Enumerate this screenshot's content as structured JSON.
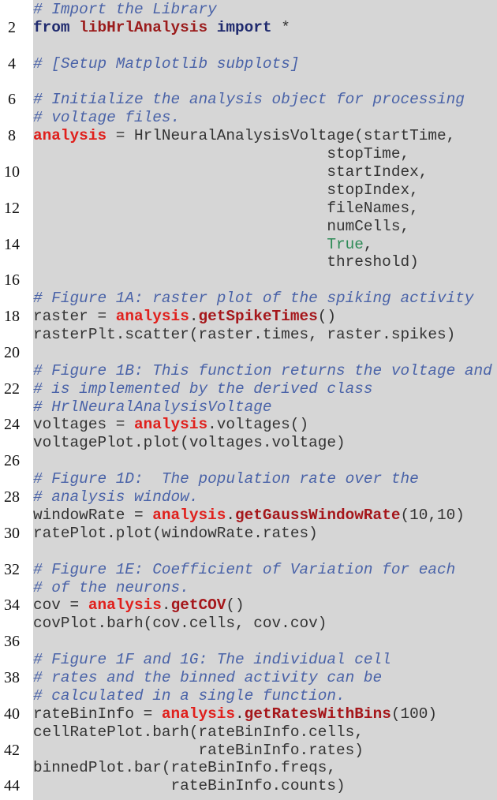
{
  "colors": {
    "background": "#d6d6d6",
    "comment": "#4a63a8",
    "keyword": "#1f2a6e",
    "module": "#9b1c1c",
    "object": "#e0201c",
    "method": "#a5161a",
    "boolean": "#2e8b57",
    "plain": "#333333"
  },
  "lines": [
    {
      "n": "",
      "tokens": [
        {
          "t": "cm",
          "v": "# Import the Library"
        }
      ]
    },
    {
      "n": "2",
      "tokens": [
        {
          "t": "kw",
          "v": "from "
        },
        {
          "t": "mod",
          "v": "libHrlAnalysis"
        },
        {
          "t": "kw",
          "v": " import"
        },
        {
          "t": "pl",
          "v": " *"
        }
      ]
    },
    {
      "n": "",
      "tokens": []
    },
    {
      "n": "4",
      "tokens": [
        {
          "t": "cm",
          "v": "# [Setup Matplotlib subplots]"
        }
      ]
    },
    {
      "n": "",
      "tokens": []
    },
    {
      "n": "6",
      "tokens": [
        {
          "t": "cm",
          "v": "# Initialize the analysis object for processing"
        }
      ]
    },
    {
      "n": "",
      "tokens": [
        {
          "t": "cm",
          "v": "# voltage files."
        }
      ]
    },
    {
      "n": "8",
      "tokens": [
        {
          "t": "obj",
          "v": "analysis"
        },
        {
          "t": "pl",
          "v": " = HrlNeuralAnalysisVoltage(startTime,"
        }
      ]
    },
    {
      "n": "",
      "tokens": [
        {
          "t": "pl",
          "v": "                                stopTime,"
        }
      ]
    },
    {
      "n": "10",
      "tokens": [
        {
          "t": "pl",
          "v": "                                startIndex,"
        }
      ]
    },
    {
      "n": "",
      "tokens": [
        {
          "t": "pl",
          "v": "                                stopIndex,"
        }
      ]
    },
    {
      "n": "12",
      "tokens": [
        {
          "t": "pl",
          "v": "                                fileNames,"
        }
      ]
    },
    {
      "n": "",
      "tokens": [
        {
          "t": "pl",
          "v": "                                numCells,"
        }
      ]
    },
    {
      "n": "14",
      "tokens": [
        {
          "t": "pl",
          "v": "                                "
        },
        {
          "t": "bool",
          "v": "True"
        },
        {
          "t": "pl",
          "v": ","
        }
      ]
    },
    {
      "n": "",
      "tokens": [
        {
          "t": "pl",
          "v": "                                threshold)"
        }
      ]
    },
    {
      "n": "16",
      "tokens": []
    },
    {
      "n": "",
      "tokens": [
        {
          "t": "cm",
          "v": "# Figure 1A: raster plot of the spiking activity"
        }
      ]
    },
    {
      "n": "18",
      "tokens": [
        {
          "t": "pl",
          "v": "raster = "
        },
        {
          "t": "obj",
          "v": "analysis"
        },
        {
          "t": "pl",
          "v": "."
        },
        {
          "t": "fn",
          "v": "getSpikeTimes"
        },
        {
          "t": "pl",
          "v": "()"
        }
      ]
    },
    {
      "n": "",
      "tokens": [
        {
          "t": "pl",
          "v": "rasterPlt.scatter(raster.times, raster.spikes)"
        }
      ]
    },
    {
      "n": "20",
      "tokens": []
    },
    {
      "n": "",
      "tokens": [
        {
          "t": "cm",
          "v": "# Figure 1B: This function returns the voltage and"
        }
      ]
    },
    {
      "n": "22",
      "tokens": [
        {
          "t": "cm",
          "v": "# is implemented by the derived class"
        }
      ]
    },
    {
      "n": "",
      "tokens": [
        {
          "t": "cm",
          "v": "# HrlNeuralAnalysisVoltage"
        }
      ]
    },
    {
      "n": "24",
      "tokens": [
        {
          "t": "pl",
          "v": "voltages = "
        },
        {
          "t": "obj",
          "v": "analysis"
        },
        {
          "t": "pl",
          "v": ".voltages()"
        }
      ]
    },
    {
      "n": "",
      "tokens": [
        {
          "t": "pl",
          "v": "voltagePlot.plot(voltages.voltage)"
        }
      ]
    },
    {
      "n": "26",
      "tokens": []
    },
    {
      "n": "",
      "tokens": [
        {
          "t": "cm",
          "v": "# Figure 1D:  The population rate over the"
        }
      ]
    },
    {
      "n": "28",
      "tokens": [
        {
          "t": "cm",
          "v": "# analysis window."
        }
      ]
    },
    {
      "n": "",
      "tokens": [
        {
          "t": "pl",
          "v": "windowRate = "
        },
        {
          "t": "obj",
          "v": "analysis"
        },
        {
          "t": "pl",
          "v": "."
        },
        {
          "t": "fn",
          "v": "getGaussWindowRate"
        },
        {
          "t": "pl",
          "v": "(10,10)"
        }
      ]
    },
    {
      "n": "30",
      "tokens": [
        {
          "t": "pl",
          "v": "ratePlot.plot(windowRate.rates)"
        }
      ]
    },
    {
      "n": "",
      "tokens": []
    },
    {
      "n": "32",
      "tokens": [
        {
          "t": "cm",
          "v": "# Figure 1E: Coefficient of Variation for each"
        }
      ]
    },
    {
      "n": "",
      "tokens": [
        {
          "t": "cm",
          "v": "# of the neurons."
        }
      ]
    },
    {
      "n": "34",
      "tokens": [
        {
          "t": "pl",
          "v": "cov = "
        },
        {
          "t": "obj",
          "v": "analysis"
        },
        {
          "t": "pl",
          "v": "."
        },
        {
          "t": "fn",
          "v": "getCOV"
        },
        {
          "t": "pl",
          "v": "()"
        }
      ]
    },
    {
      "n": "",
      "tokens": [
        {
          "t": "pl",
          "v": "covPlot.barh(cov.cells, cov.cov)"
        }
      ]
    },
    {
      "n": "36",
      "tokens": []
    },
    {
      "n": "",
      "tokens": [
        {
          "t": "cm",
          "v": "# Figure 1F and 1G: The individual cell"
        }
      ]
    },
    {
      "n": "38",
      "tokens": [
        {
          "t": "cm",
          "v": "# rates and the binned activity can be"
        }
      ]
    },
    {
      "n": "",
      "tokens": [
        {
          "t": "cm",
          "v": "# calculated in a single function."
        }
      ]
    },
    {
      "n": "40",
      "tokens": [
        {
          "t": "pl",
          "v": "rateBinInfo = "
        },
        {
          "t": "obj",
          "v": "analysis"
        },
        {
          "t": "pl",
          "v": "."
        },
        {
          "t": "fn",
          "v": "getRatesWithBins"
        },
        {
          "t": "pl",
          "v": "(100)"
        }
      ]
    },
    {
      "n": "",
      "tokens": [
        {
          "t": "pl",
          "v": "cellRatePlot.barh(rateBinInfo.cells,"
        }
      ]
    },
    {
      "n": "42",
      "tokens": [
        {
          "t": "pl",
          "v": "                  rateBinInfo.rates)"
        }
      ]
    },
    {
      "n": "",
      "tokens": [
        {
          "t": "pl",
          "v": "binnedPlot.bar(rateBinInfo.freqs,"
        }
      ]
    },
    {
      "n": "44",
      "tokens": [
        {
          "t": "pl",
          "v": "               rateBinInfo.counts)"
        }
      ]
    }
  ]
}
